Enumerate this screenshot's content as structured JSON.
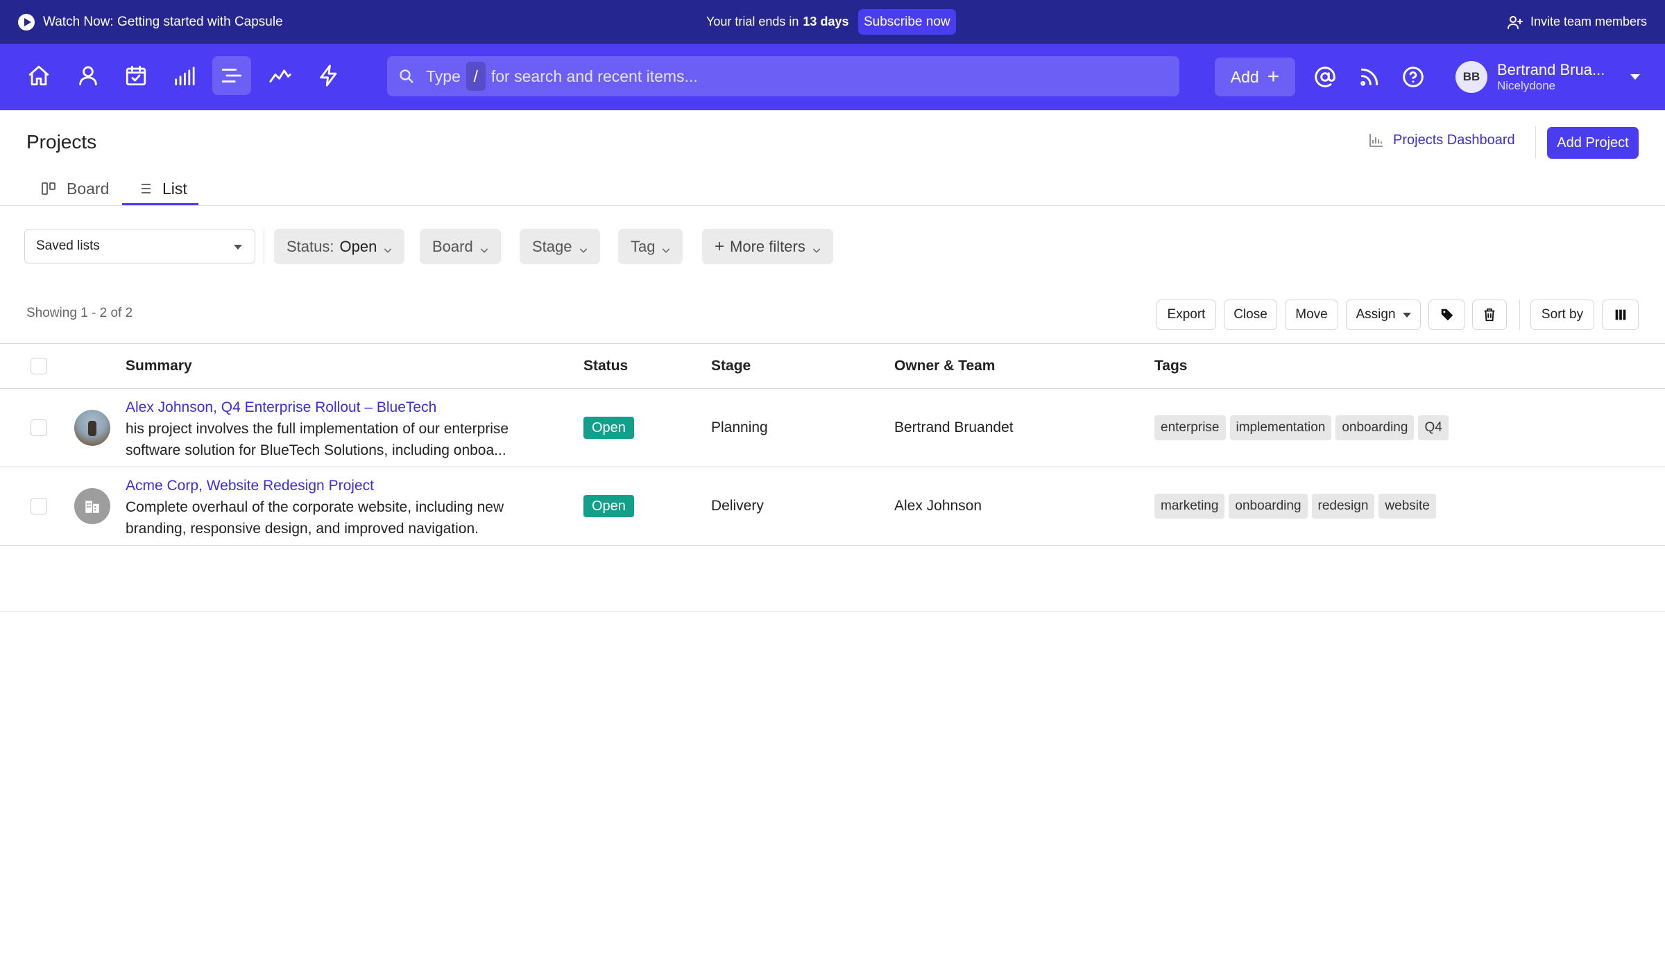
{
  "banner": {
    "watch_label": "Watch Now: Getting started with Capsule",
    "trial_prefix": "Your trial ends in",
    "trial_days": "13 days",
    "subscribe_label": "Subscribe now",
    "invite_label": "Invite team members"
  },
  "nav": {
    "icons": [
      "home-icon",
      "person-icon",
      "calendar-check-icon",
      "bar-chart-icon",
      "projects-list-icon",
      "trend-line-icon",
      "lightning-icon"
    ],
    "active": "projects-list-icon",
    "search_prefix": "Type",
    "search_key": "/",
    "search_suffix": "for search and recent items...",
    "add_label": "Add",
    "user_initials": "BB",
    "user_name": "Bertrand Brua...",
    "user_org": "Nicelydone"
  },
  "page": {
    "title": "Projects",
    "dashboard_link": "Projects Dashboard",
    "add_project_label": "Add Project",
    "tabs": [
      {
        "label": "Board",
        "active": false
      },
      {
        "label": "List",
        "active": true
      }
    ]
  },
  "filters": {
    "saved_lists": "Saved lists",
    "status_label": "Status:",
    "status_value": "Open",
    "board": "Board",
    "stage": "Stage",
    "tag": "Tag",
    "more_filters": "More filters"
  },
  "toolbar": {
    "showing": "Showing 1 - 2 of 2",
    "export": "Export",
    "close": "Close",
    "move": "Move",
    "assign": "Assign",
    "sort_by": "Sort by"
  },
  "table": {
    "columns": [
      "Summary",
      "Status",
      "Stage",
      "Owner & Team",
      "Tags"
    ],
    "rows": [
      {
        "title": "Alex Johnson, Q4 Enterprise Rollout – BlueTech",
        "desc_line1": "his project involves the full implementation of our enterprise",
        "desc_line2": "software solution for BlueTech Solutions, including onboa...",
        "status": "Open",
        "stage": "Planning",
        "owner": "Bertrand Bruandet",
        "tags": [
          "enterprise",
          "implementation",
          "onboarding",
          "Q4"
        ]
      },
      {
        "title": "Acme Corp, Website Redesign Project",
        "desc_line1": "Complete overhaul of the corporate website, including new",
        "desc_line2": "branding, responsive design, and improved navigation.",
        "status": "Open",
        "stage": "Delivery",
        "owner": "Alex Johnson",
        "tags": [
          "marketing",
          "onboarding",
          "redesign",
          "website"
        ]
      }
    ]
  },
  "colors": {
    "banner_bg": "#262690",
    "nav_bg": "#4c3cf4",
    "accent": "#4a3df0",
    "status_open": "#13a08a"
  }
}
